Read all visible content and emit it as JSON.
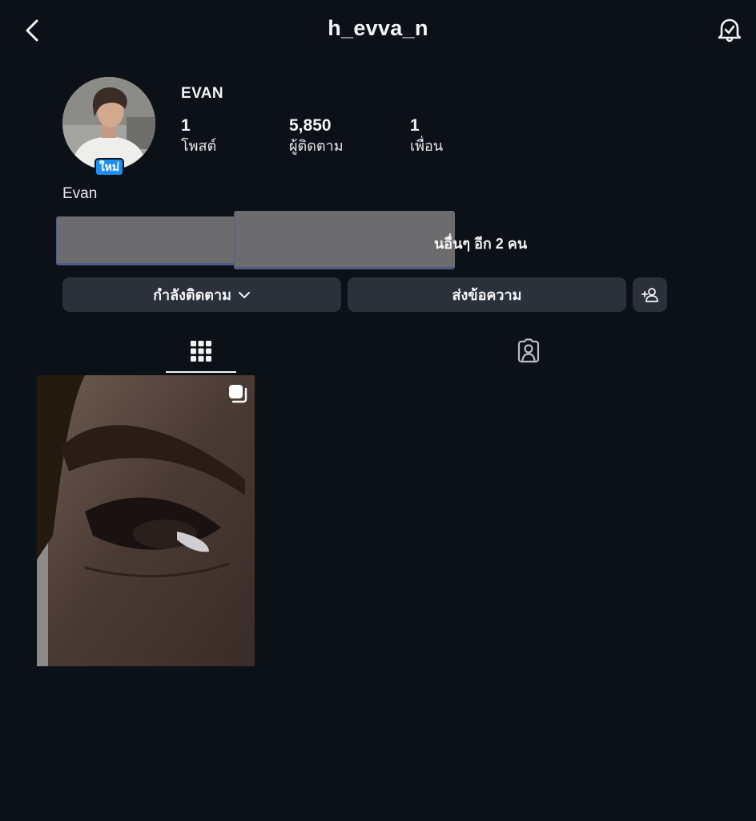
{
  "header": {
    "username": "h_evva_n",
    "back_icon": "chevron-left-icon",
    "notification_icon": "bell-check-icon"
  },
  "profile": {
    "display_name": "EVAN",
    "new_badge": "ใหม่",
    "bio": "Evan",
    "stats": [
      {
        "value": "1",
        "label": "โพสต์"
      },
      {
        "value": "5,850",
        "label": "ผู้ติดตาม"
      },
      {
        "value": "1",
        "label": "เพื่อน"
      }
    ],
    "mutual_text": "นอื่นๆ อีก 2 คน"
  },
  "actions": {
    "following_label": "กำลังติดตาม",
    "message_label": "ส่งข้อความ",
    "add_friend_icon": "add-person-icon"
  },
  "tabs": [
    {
      "icon": "grid-icon",
      "active": true
    },
    {
      "icon": "tagged-person-icon",
      "active": false
    }
  ],
  "colors": {
    "background": "#0c1117",
    "button": "#2b313a",
    "badge": "#1e8ff0",
    "text": "#f4f4f5"
  }
}
